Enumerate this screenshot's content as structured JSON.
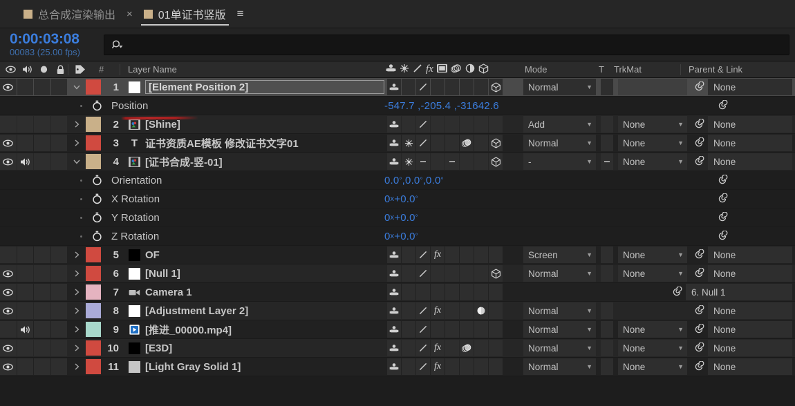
{
  "app": "After Effects Timeline",
  "tabs": [
    {
      "label": "总合成渲染输出",
      "active": false,
      "swatch": "#c9b089",
      "close": "×"
    },
    {
      "label": "01单证书竖版",
      "active": true,
      "swatch": "#c9b089",
      "menu": "≡"
    }
  ],
  "timecode": {
    "current": "0:00:03:08",
    "frames_fps": "00083 (25.00 fps)",
    "color": "#3b7ddd"
  },
  "search": {
    "placeholder": "",
    "value": "",
    "icon": "search-icon"
  },
  "columns": {
    "av_icons": [
      "eye-icon",
      "speaker-icon",
      "solo-icon",
      "lock-icon"
    ],
    "label": "label-tag-icon",
    "number": "#",
    "layer_name": "Layer Name",
    "switch_icons": [
      "shy-icon",
      "collapse-transform-icon",
      "quality-icon",
      "effects-fx-icon",
      "frame-blend-icon",
      "motion-blur-icon",
      "adjustment-icon",
      "3d-layer-icon"
    ],
    "mode": "Mode",
    "t": "T",
    "trkmat": "TrkMat",
    "parent": "Parent & Link"
  },
  "rows": [
    {
      "kind": "layer",
      "num": "1",
      "name": "[Element Position 2]",
      "editing": true,
      "selected": true,
      "eye": true,
      "audio": false,
      "label_color": "#d04a40",
      "src": "white-solid",
      "twirl": "down",
      "sw": {
        "shy": true,
        "collapse": false,
        "quality": true,
        "fx": false,
        "frameblend": false,
        "motionblur": false,
        "adjust": false,
        "threed": true
      },
      "mode": "Normal",
      "t": "",
      "trkmat": "",
      "trkmat_present": false,
      "parent": "None",
      "bold": true
    },
    {
      "kind": "property",
      "prop_name": "Position",
      "value": "-547.7 ,-205.4 ,-31642.6",
      "stopwatch": "stopwatch-icon"
    },
    {
      "kind": "layer",
      "num": "2",
      "name": "[Shine]",
      "editing": false,
      "selected": false,
      "eye": false,
      "audio": false,
      "label_color": "#c9b089",
      "src": "comp",
      "twirl": "right",
      "sw": {
        "shy": true,
        "collapse": false,
        "quality": true,
        "fx": false,
        "frameblend": false,
        "motionblur": false,
        "adjust": false,
        "threed": false
      },
      "mode": "Add",
      "t": "",
      "trkmat": "None",
      "trkmat_present": true,
      "parent": "None",
      "bold": true
    },
    {
      "kind": "layer",
      "num": "3",
      "name": "证书资质AE模板 修改证书文字01",
      "editing": false,
      "selected": false,
      "eye": true,
      "audio": false,
      "label_color": "#d04a40",
      "src": "text-T",
      "twirl": "right",
      "sw": {
        "shy": true,
        "collapse": true,
        "quality": true,
        "fx": false,
        "frameblend": false,
        "motionblur": true,
        "adjust": false,
        "threed": true
      },
      "mode": "Normal",
      "t": "",
      "trkmat": "None",
      "trkmat_present": true,
      "parent": "None",
      "bold": true
    },
    {
      "kind": "layer",
      "num": "4",
      "name": "[证书合成-竖-01]",
      "editing": false,
      "selected": false,
      "eye": true,
      "audio": true,
      "label_color": "#c9b089",
      "src": "comp",
      "twirl": "down",
      "sw": {
        "shy": true,
        "collapse": true,
        "quality": "dash",
        "fx": false,
        "frameblend": "dash",
        "motionblur": false,
        "adjust": false,
        "threed": true
      },
      "mode": "-",
      "t": "-",
      "trkmat": "None",
      "trkmat_present": true,
      "parent": "None",
      "bold": true
    },
    {
      "kind": "property",
      "prop_name": "Orientation",
      "value": "0.0°,0.0°,0.0°",
      "stopwatch": "stopwatch-icon"
    },
    {
      "kind": "property",
      "prop_name": "X Rotation",
      "value": "0x+0.0°",
      "stopwatch": "stopwatch-icon"
    },
    {
      "kind": "property",
      "prop_name": "Y Rotation",
      "value": "0x+0.0°",
      "stopwatch": "stopwatch-icon"
    },
    {
      "kind": "property",
      "prop_name": "Z Rotation",
      "value": "0x+0.0°",
      "stopwatch": "stopwatch-icon"
    },
    {
      "kind": "layer",
      "num": "5",
      "name": "OF",
      "editing": false,
      "selected": false,
      "eye": false,
      "audio": false,
      "label_color": "#d04a40",
      "src": "black-solid",
      "twirl": "right",
      "sw": {
        "shy": true,
        "collapse": false,
        "quality": true,
        "fx": true,
        "frameblend": false,
        "motionblur": false,
        "adjust": false,
        "threed": false
      },
      "mode": "Screen",
      "t": "",
      "trkmat": "None",
      "trkmat_present": true,
      "parent": "None",
      "bold": true
    },
    {
      "kind": "layer",
      "num": "6",
      "name": "[Null 1]",
      "editing": false,
      "selected": false,
      "eye": true,
      "audio": false,
      "label_color": "#d04a40",
      "src": "white-solid",
      "twirl": "right",
      "sw": {
        "shy": true,
        "collapse": false,
        "quality": true,
        "fx": false,
        "frameblend": false,
        "motionblur": false,
        "adjust": false,
        "threed": true
      },
      "mode": "Normal",
      "t": "",
      "trkmat": "None",
      "trkmat_present": true,
      "parent": "None",
      "bold": true
    },
    {
      "kind": "layer",
      "num": "7",
      "name": "Camera 1",
      "editing": false,
      "selected": false,
      "eye": true,
      "audio": false,
      "label_color": "#e5b3c0",
      "src": "camera-icon",
      "twirl": "right",
      "sw": {
        "shy": true,
        "collapse": false,
        "quality": false,
        "fx": false,
        "frameblend": false,
        "motionblur": false,
        "adjust": false,
        "threed": false
      },
      "mode": "",
      "t": "",
      "trkmat": "",
      "trkmat_present": false,
      "parent": "6. Null 1",
      "bold": true,
      "no_mode": true
    },
    {
      "kind": "layer",
      "num": "8",
      "name": "[Adjustment Layer 2]",
      "editing": false,
      "selected": false,
      "eye": true,
      "audio": false,
      "label_color": "#aaabd8",
      "src": "white-solid",
      "twirl": "right",
      "sw": {
        "shy": true,
        "collapse": false,
        "quality": true,
        "fx": true,
        "frameblend": false,
        "motionblur": false,
        "adjust": true,
        "threed": false
      },
      "mode": "Normal",
      "t": "",
      "trkmat": "",
      "trkmat_present": false,
      "parent": "None",
      "bold": true
    },
    {
      "kind": "layer",
      "num": "9",
      "name": "[推进_00000.mp4]",
      "editing": false,
      "selected": false,
      "eye": false,
      "audio": true,
      "label_color": "#a8d8cb",
      "src": "video-icon",
      "twirl": "right",
      "sw": {
        "shy": true,
        "collapse": false,
        "quality": true,
        "fx": false,
        "frameblend": false,
        "motionblur": false,
        "adjust": false,
        "threed": false
      },
      "mode": "Normal",
      "t": "",
      "trkmat": "None",
      "trkmat_present": true,
      "parent": "None",
      "bold": true
    },
    {
      "kind": "layer",
      "num": "10",
      "name": "[E3D]",
      "editing": false,
      "selected": false,
      "eye": true,
      "audio": false,
      "label_color": "#d04a40",
      "src": "black-solid",
      "twirl": "right",
      "sw": {
        "shy": true,
        "collapse": false,
        "quality": true,
        "fx": true,
        "frameblend": false,
        "motionblur": true,
        "adjust": false,
        "threed": false
      },
      "mode": "Normal",
      "t": "",
      "trkmat": "None",
      "trkmat_present": true,
      "parent": "None",
      "bold": true
    },
    {
      "kind": "layer",
      "num": "11",
      "name": "[Light Gray Solid 1]",
      "editing": false,
      "selected": false,
      "eye": true,
      "audio": false,
      "label_color": "#d04a40",
      "src": "gray-solid",
      "twirl": "right",
      "sw": {
        "shy": true,
        "collapse": false,
        "quality": true,
        "fx": true,
        "frameblend": false,
        "motionblur": false,
        "adjust": false,
        "threed": false
      },
      "mode": "Normal",
      "t": "",
      "trkmat": "None",
      "trkmat_present": true,
      "parent": "None",
      "bold": true
    }
  ],
  "annotation": {
    "type": "red-underline-stroke",
    "color": "#b52626"
  }
}
